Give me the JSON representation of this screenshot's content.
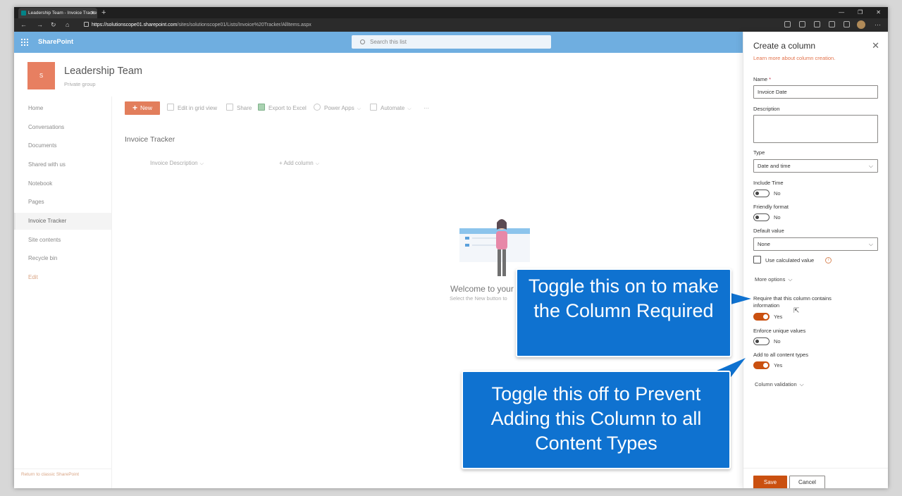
{
  "browser": {
    "tab_title": "Leadership Team - Invoice Tracke",
    "url_host": "https://solutionscope01.sharepoint.com",
    "url_path": "/sites/solutionscope01/Lists/Invoice%20Tracker/AllItems.aspx"
  },
  "suite": {
    "brand": "SharePoint",
    "search_placeholder": "Search this list",
    "color": "#6faee0"
  },
  "site": {
    "logo_letter": "S",
    "title": "Leadership Team",
    "subtitle": "Private group",
    "logo_color": "#e77f61"
  },
  "nav": {
    "items": [
      "Home",
      "Conversations",
      "Documents",
      "Shared with us",
      "Notebook",
      "Pages",
      "Invoice Tracker",
      "Site contents",
      "Recycle bin",
      "Edit"
    ],
    "selected": "Invoice Tracker",
    "return_link": "Return to classic SharePoint"
  },
  "commandbar": {
    "new": "New",
    "edit_grid": "Edit in grid view",
    "share": "Share",
    "export": "Export to Excel",
    "powerapps": "Power Apps",
    "automate": "Automate",
    "more": "···"
  },
  "list": {
    "title": "Invoice Tracker",
    "columns": [
      "Invoice Description",
      "Add column"
    ],
    "empty_title": "Welcome to your",
    "empty_sub": "Select the New button to"
  },
  "callouts": {
    "first": "Toggle this on to make the Column Required",
    "second": "Toggle this off to Prevent Adding this Column to all Content Types",
    "color": "#0f72d0"
  },
  "panel": {
    "title": "Create a column",
    "learn_more": "Learn more about column creation.",
    "name_label": "Name",
    "name_required_mark": "*",
    "name_value": "Invoice Date",
    "description_label": "Description",
    "type_label": "Type",
    "type_value": "Date and time",
    "include_time_label": "Include Time",
    "include_time_state": "No",
    "friendly_format_label": "Friendly format",
    "friendly_format_state": "No",
    "default_value_label": "Default value",
    "default_value": "None",
    "use_calculated": "Use calculated value",
    "more_options": "More options",
    "require_label": "Require that this column contains information",
    "require_state": "Yes",
    "unique_label": "Enforce unique values",
    "unique_state": "No",
    "content_types_label": "Add to all content types",
    "content_types_state": "Yes",
    "column_validation": "Column validation",
    "save": "Save",
    "cancel": "Cancel",
    "accent": "#ca5010"
  }
}
